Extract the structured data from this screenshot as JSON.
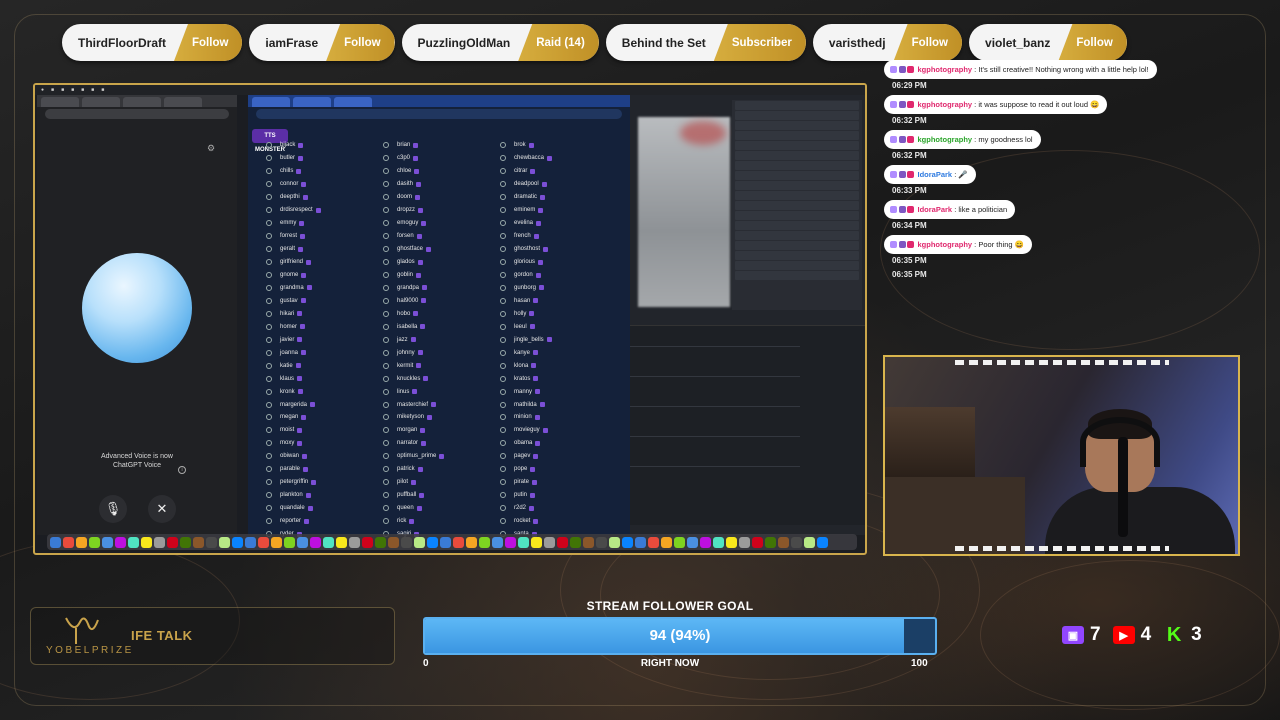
{
  "events": [
    {
      "name": "ThirdFloorDraft",
      "type": "Follow"
    },
    {
      "name": "iamFrase",
      "type": "Follow"
    },
    {
      "name": "PuzzlingOldMan",
      "type": "Raid (14)"
    },
    {
      "name": "Behind the Set",
      "type": "Subscriber"
    },
    {
      "name": "varisthedj",
      "type": "Follow"
    },
    {
      "name": "violet_banz",
      "type": "Follow"
    }
  ],
  "screen": {
    "voice_note_line1": "Advanced Voice is now",
    "voice_note_line2": "ChatGPT Voice",
    "voices_logo": "TTS MONSTER",
    "voice_columns": [
      [
        "bijack",
        "butler",
        "chills",
        "connor",
        "deepthi",
        "drdisrespect",
        "emmy",
        "forrest",
        "geralt",
        "girlfriend",
        "gnome",
        "grandma",
        "gustav",
        "hikari",
        "homer",
        "javier",
        "joanna",
        "katie",
        "klaus",
        "kronk",
        "margerida",
        "megan",
        "moist",
        "moxy",
        "obiwan",
        "parable",
        "petergriffin",
        "plankton",
        "quandale",
        "reporter",
        "ryder"
      ],
      [
        "brian",
        "c3p0",
        "chloe",
        "dasith",
        "doom",
        "dropzz",
        "emoguy",
        "forsen",
        "ghostface",
        "glados",
        "goblin",
        "grandpa",
        "hal9000",
        "hobo",
        "isabella",
        "jazz",
        "johnny",
        "kermit",
        "knuckles",
        "linus",
        "masterchief",
        "miketyson",
        "morgan",
        "narrator",
        "optimus_prime",
        "patrick",
        "pilot",
        "puffball",
        "queen",
        "rick",
        "sagiri"
      ],
      [
        "brok",
        "chewbacca",
        "citrar",
        "deadpool",
        "dramatic",
        "eminem",
        "evelina",
        "french",
        "ghosthost",
        "glorious",
        "gordon",
        "gunborg",
        "hasan",
        "holly",
        "leeul",
        "jingle_bells",
        "kanye",
        "klona",
        "kratos",
        "manny",
        "mathilda",
        "minion",
        "movieguy",
        "obama",
        "pagev",
        "pope",
        "pirate",
        "putin",
        "r2d2",
        "rocket",
        "santa"
      ]
    ]
  },
  "chat": [
    {
      "time": "06:29 PM",
      "user": "kgphotography",
      "user_color": "#e0286e",
      "text": "It's still creative!! Nothing wrong with a little help lol!"
    },
    {
      "time": "06:32 PM",
      "user": "kgphotography",
      "user_color": "#e0286e",
      "text": "it was suppose to read it out loud 😄"
    },
    {
      "time": "06:32 PM",
      "user": "kgphotography",
      "user_color": "#2aa52a",
      "text": "my goodness lol"
    },
    {
      "time": "06:33 PM",
      "user": "IdoraPark",
      "user_color": "#2f7be0",
      "text": "🎤"
    },
    {
      "time": "06:34 PM",
      "user": "IdoraPark",
      "user_color": "#e0286e",
      "text": "like a politician"
    },
    {
      "time": "06:35 PM",
      "user": "kgphotography",
      "user_color": "#e0286e",
      "text": "Poor thing 😄"
    },
    {
      "time": "06:35 PM",
      "user": "",
      "user_color": "",
      "text": ""
    }
  ],
  "brand": {
    "name": "YOBELPRIZE",
    "show": "IFE TALK"
  },
  "goal": {
    "title": "STREAM FOLLOWER GOAL",
    "value_text": "94 (94%)",
    "current": 94,
    "target": 100,
    "min_label": "0",
    "max_label": "100",
    "sub_label": "RIGHT NOW",
    "fill_color": "#3b96e2"
  },
  "social": [
    {
      "icon": "twitch-icon",
      "count": "7",
      "color": "#9146ff"
    },
    {
      "icon": "youtube-icon",
      "count": "4",
      "color": "#ff0000"
    },
    {
      "icon": "kick-icon",
      "count": "3",
      "color": "#53fc18"
    }
  ],
  "colors": {
    "accent_gold": "#c9a54b",
    "event_gold": "#d6ad3e"
  }
}
